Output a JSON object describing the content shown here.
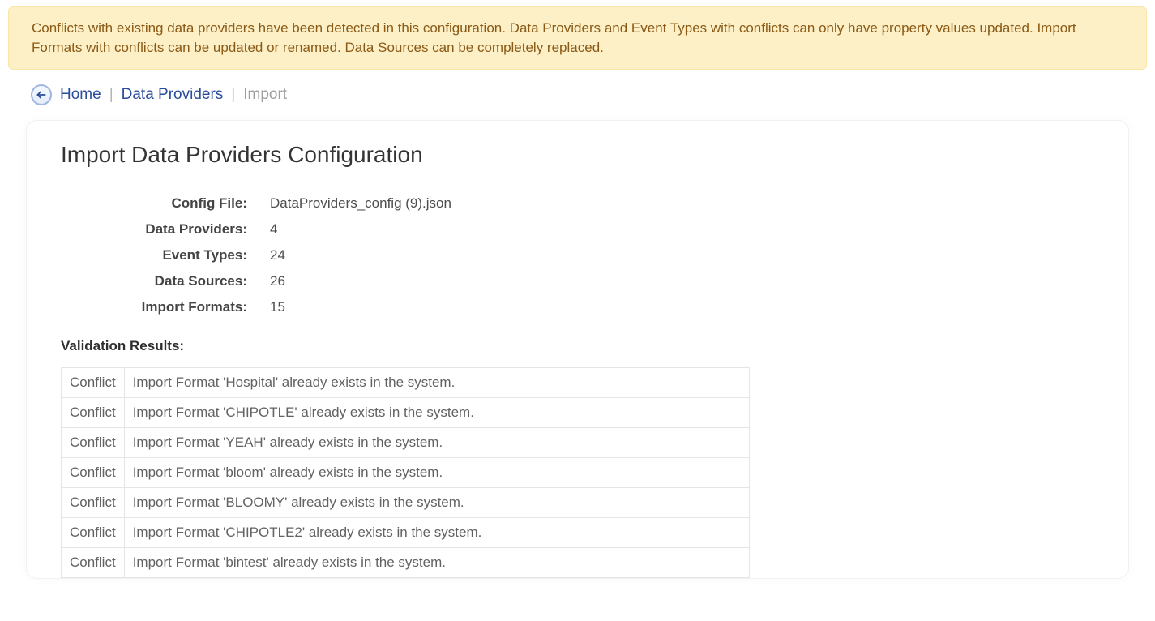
{
  "alert": {
    "text": "Conflicts with existing data providers have been detected in this configuration. Data Providers and Event Types with conflicts can only have property values updated. Import Formats with conflicts can be updated or renamed. Data Sources can be completely replaced."
  },
  "breadcrumb": {
    "home": "Home",
    "data_providers": "Data Providers",
    "current": "Import"
  },
  "page": {
    "title": "Import Data Providers Configuration"
  },
  "summary": {
    "config_file_label": "Config File:",
    "config_file_value": "DataProviders_config (9).json",
    "data_providers_label": "Data Providers:",
    "data_providers_value": "4",
    "event_types_label": "Event Types:",
    "event_types_value": "24",
    "data_sources_label": "Data Sources:",
    "data_sources_value": "26",
    "import_formats_label": "Import Formats:",
    "import_formats_value": "15"
  },
  "validation": {
    "label": "Validation Results:",
    "rows": [
      {
        "status": "Conflict",
        "message": "Import Format 'Hospital' already exists in the system."
      },
      {
        "status": "Conflict",
        "message": "Import Format 'CHIPOTLE' already exists in the system."
      },
      {
        "status": "Conflict",
        "message": "Import Format 'YEAH' already exists in the system."
      },
      {
        "status": "Conflict",
        "message": "Import Format 'bloom' already exists in the system."
      },
      {
        "status": "Conflict",
        "message": "Import Format 'BLOOMY' already exists in the system."
      },
      {
        "status": "Conflict",
        "message": "Import Format 'CHIPOTLE2' already exists in the system."
      },
      {
        "status": "Conflict",
        "message": "Import Format 'bintest' already exists in the system."
      }
    ]
  }
}
